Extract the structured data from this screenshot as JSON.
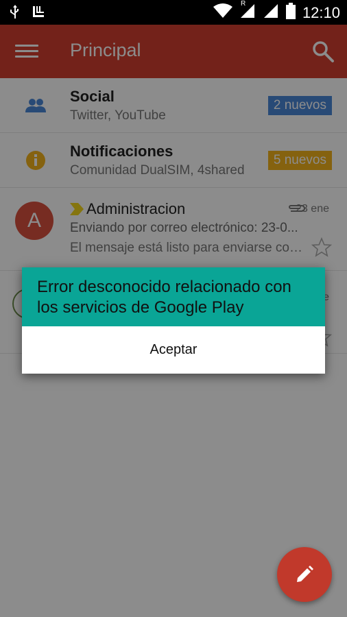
{
  "status_bar": {
    "time": "12:10",
    "signal_label": "R"
  },
  "app_bar": {
    "title": "Principal"
  },
  "categories": [
    {
      "title": "Social",
      "subtitle": "Twitter, YouTube",
      "badge": "2 nuevos",
      "badge_color": "#4a87d8"
    },
    {
      "title": "Notificaciones",
      "subtitle": "Comunidad DualSIM, 4shared",
      "badge": "5 nuevos",
      "badge_color": "#f3b21d"
    }
  ],
  "emails": [
    {
      "avatar_letter": "A",
      "sender": "Administracion",
      "date": "23 ene",
      "subject": "Enviando por correo electrónico: 23-0...",
      "snippet": "El mensaje está listo para enviarse con..."
    },
    {
      "date_partial": "e"
    }
  ],
  "dialog": {
    "title": "Error desconocido relacionado con los servicios de Google Play",
    "button": "Aceptar"
  },
  "colors": {
    "app_bar": "#d23f31",
    "dialog_header": "#0aa596",
    "fab": "#c1392b"
  },
  "icons": [
    "usb-icon",
    "notification-icon",
    "wifi-icon",
    "signal-icon",
    "battery-icon",
    "menu-icon",
    "search-icon",
    "people-icon",
    "info-icon",
    "important-marker-icon",
    "attachment-icon",
    "star-icon",
    "pencil-icon"
  ]
}
